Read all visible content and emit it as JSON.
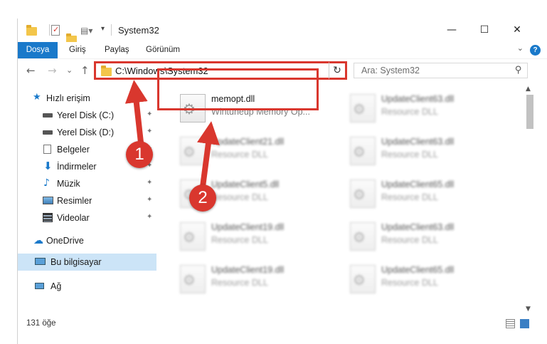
{
  "window": {
    "title": "System32",
    "minimize_glyph": "—",
    "maximize_glyph": "☐",
    "close_glyph": "✕"
  },
  "ribbon": {
    "tabs": [
      "Dosya",
      "Giriş",
      "Paylaş",
      "Görünüm"
    ],
    "collapse_glyph": "⌄",
    "help_glyph": "?"
  },
  "nav": {
    "back_glyph": "←",
    "forward_glyph": "→",
    "recent_glyph": "⌄",
    "up_glyph": "↑",
    "address": "C:\\Windows\\System32",
    "address_dropdown_glyph": "⌄",
    "refresh_glyph": "↻",
    "search_placeholder": "Ara: System32",
    "search_glyph": "⚲"
  },
  "sidebar": {
    "quick_access": "Hızlı erişim",
    "items": [
      {
        "label": "Yerel Disk (C:)",
        "icon": "drive-icon"
      },
      {
        "label": "Yerel Disk (D:)",
        "icon": "drive-icon"
      },
      {
        "label": "Belgeler",
        "icon": "documents-icon"
      },
      {
        "label": "İndirmeler",
        "icon": "download-icon"
      },
      {
        "label": "Müzik",
        "icon": "music-icon"
      },
      {
        "label": "Resimler",
        "icon": "pictures-icon"
      },
      {
        "label": "Videolar",
        "icon": "videos-icon"
      }
    ],
    "onedrive": "OneDrive",
    "this_pc": "Bu bilgisayar",
    "network": "Ağ",
    "pin_glyph": "📌"
  },
  "files": {
    "left": [
      {
        "name": "memopt.dll",
        "desc": "Wintuneup Memory Op..."
      },
      {
        "name": "UpdateClient21.dll",
        "desc": "Resource DLL"
      },
      {
        "name": "UpdateClient5.dll",
        "desc": "Resource DLL"
      },
      {
        "name": "UpdateClient19.dll",
        "desc": "Resource DLL"
      },
      {
        "name": "UpdateClient19.dll",
        "desc": "Resource DLL"
      }
    ],
    "right": [
      {
        "name": "UpdateClient63.dll",
        "desc": "Resource DLL"
      },
      {
        "name": "UpdateClient63.dll",
        "desc": "Resource DLL"
      },
      {
        "name": "UpdateClient65.dll",
        "desc": "Resource DLL"
      },
      {
        "name": "UpdateClient63.dll",
        "desc": "Resource DLL"
      },
      {
        "name": "UpdateClient65.dll",
        "desc": "Resource DLL"
      }
    ],
    "gear_glyph": "⚙"
  },
  "scrollbar": {
    "up_glyph": "▲",
    "down_glyph": "▼"
  },
  "status": {
    "count": "131 öğe"
  },
  "annotations": {
    "step1": "1",
    "step2": "2",
    "color": "#d9372e"
  }
}
